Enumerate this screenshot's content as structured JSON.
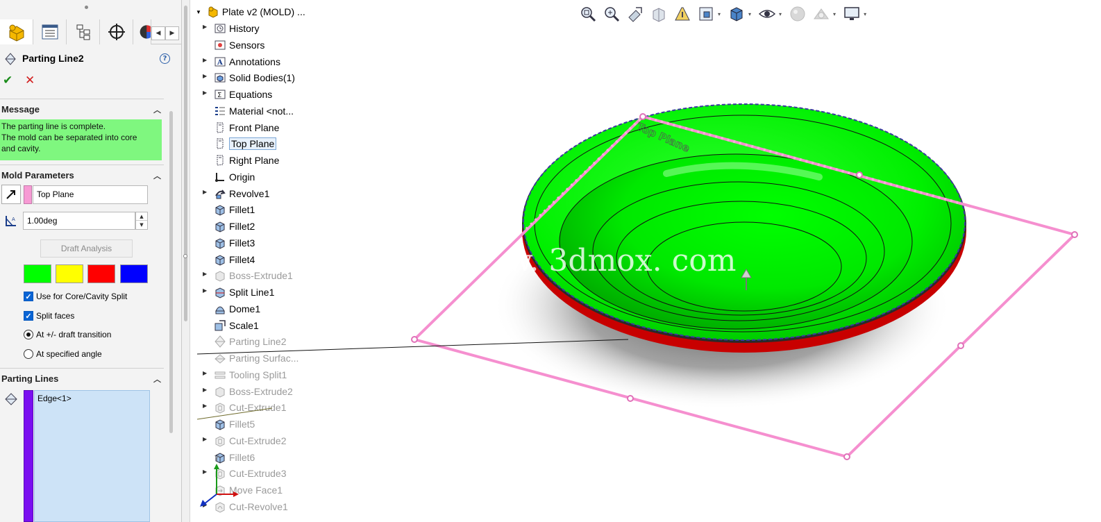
{
  "property_manager": {
    "title": "Parting Line2",
    "help": "?",
    "tab_nav": {
      "prev": "◀",
      "next": "▶"
    },
    "sections": {
      "message": {
        "header": "Message",
        "text_lines": [
          "The parting line is complete.",
          "The mold can be separated into core",
          "and cavity."
        ]
      },
      "mold_parameters": {
        "header": "Mold Parameters",
        "direction_ref": "Top Plane",
        "draft_angle": "1.00deg",
        "draft_button": "Draft Analysis",
        "colors": [
          "#00ff00",
          "#ffff00",
          "#ff0000",
          "#0000ff"
        ],
        "options": [
          {
            "label": "Use for Core/Cavity Split",
            "type": "checkbox",
            "checked": true
          },
          {
            "label": "Split faces",
            "type": "checkbox",
            "checked": true
          },
          {
            "label": "At +/- draft transition",
            "type": "radio",
            "checked": true
          },
          {
            "label": "At specified angle",
            "type": "radio",
            "checked": false
          }
        ]
      },
      "parting_lines": {
        "header": "Parting Lines",
        "items": [
          "Edge<1>"
        ],
        "swatch_color": "#7a0ff0"
      }
    }
  },
  "feature_tree": {
    "root": "Plate v2 (MOLD) ...",
    "items": [
      {
        "label": "History",
        "icon": "history-icon",
        "expand": true,
        "dim": false
      },
      {
        "label": "Sensors",
        "icon": "sensor-icon",
        "expand": false,
        "dim": false
      },
      {
        "label": "Annotations",
        "icon": "annotation-icon",
        "expand": true,
        "dim": false
      },
      {
        "label": "Solid Bodies(1)",
        "icon": "solid-bodies-icon",
        "expand": true,
        "dim": false
      },
      {
        "label": "Equations",
        "icon": "equation-icon",
        "expand": true,
        "dim": false
      },
      {
        "label": "Material <not...",
        "icon": "material-icon",
        "expand": false,
        "dim": false
      },
      {
        "label": "Front Plane",
        "icon": "plane-icon",
        "expand": false,
        "dim": false
      },
      {
        "label": "Top Plane",
        "icon": "plane-icon",
        "expand": false,
        "dim": false,
        "selected": true
      },
      {
        "label": "Right Plane",
        "icon": "plane-icon",
        "expand": false,
        "dim": false
      },
      {
        "label": "Origin",
        "icon": "origin-icon",
        "expand": false,
        "dim": false
      },
      {
        "label": "Revolve1",
        "icon": "revolve-icon",
        "expand": true,
        "dim": false
      },
      {
        "label": "Fillet1",
        "icon": "fillet-icon",
        "expand": false,
        "dim": false
      },
      {
        "label": "Fillet2",
        "icon": "fillet-icon",
        "expand": false,
        "dim": false
      },
      {
        "label": "Fillet3",
        "icon": "fillet-icon",
        "expand": false,
        "dim": false
      },
      {
        "label": "Fillet4",
        "icon": "fillet-icon",
        "expand": false,
        "dim": false
      },
      {
        "label": "Boss-Extrude1",
        "icon": "extrude-icon",
        "expand": true,
        "dim": true
      },
      {
        "label": "Split Line1",
        "icon": "split-line-icon",
        "expand": true,
        "dim": false
      },
      {
        "label": "Dome1",
        "icon": "dome-icon",
        "expand": false,
        "dim": false
      },
      {
        "label": "Scale1",
        "icon": "scale-icon",
        "expand": false,
        "dim": false
      },
      {
        "label": "Parting Line2",
        "icon": "parting-line-icon",
        "expand": false,
        "dim": true
      },
      {
        "label": "Parting Surfac...",
        "icon": "parting-surface-icon",
        "expand": false,
        "dim": true
      },
      {
        "label": "Tooling Split1",
        "icon": "tooling-split-icon",
        "expand": true,
        "dim": true
      },
      {
        "label": "Boss-Extrude2",
        "icon": "extrude-icon",
        "expand": true,
        "dim": true
      },
      {
        "label": "Cut-Extrude1",
        "icon": "cut-extrude-icon",
        "expand": true,
        "dim": true
      },
      {
        "label": "Fillet5",
        "icon": "fillet-icon",
        "expand": false,
        "dim": true
      },
      {
        "label": "Cut-Extrude2",
        "icon": "cut-extrude-icon",
        "expand": true,
        "dim": true
      },
      {
        "label": "Fillet6",
        "icon": "fillet-icon",
        "expand": false,
        "dim": true
      },
      {
        "label": "Cut-Extrude3",
        "icon": "cut-extrude-icon",
        "expand": true,
        "dim": true
      },
      {
        "label": "Move Face1",
        "icon": "move-face-icon",
        "expand": false,
        "dim": true
      },
      {
        "label": "Cut-Revolve1",
        "icon": "cut-revolve-icon",
        "expand": true,
        "dim": true
      }
    ]
  },
  "viewport": {
    "plane_label": "Top Plane",
    "watermark": "w. 3dmox. com",
    "triad_label": "Y",
    "colors": {
      "part": "#00ff00",
      "plane": "#f58fcf",
      "underside": "#d40000"
    }
  },
  "toolbar": {
    "icons": [
      "zoom-to-fit-icon",
      "zoom-area-icon",
      "previous-view-icon",
      "section-view-icon",
      "dynamic-annotation-icon",
      "view-orientation-icon",
      "display-style-icon",
      "hide-show-icon",
      "appearance-icon",
      "scene-icon",
      "view-settings-icon"
    ],
    "dropdown_glyph": "▾"
  }
}
